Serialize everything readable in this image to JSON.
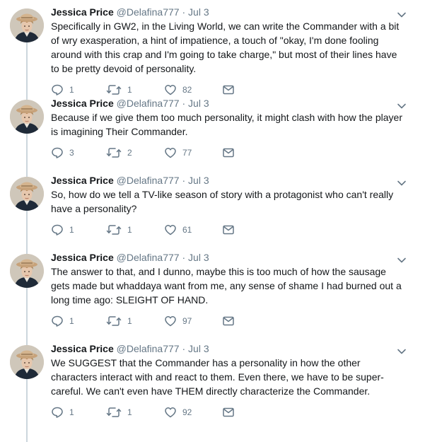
{
  "tweets": [
    {
      "name": "Jessica Price",
      "handle": "@Delafina777",
      "dot": "·",
      "date": "Jul 3",
      "text": "Specifically in GW2, in the Living World, we can write the Commander with a bit of wry exasperation, a hint of impatience, a touch of \"okay, I'm done fooling around with this crap and I'm going to take charge,\" but most of their lines have to be pretty devoid of personality.",
      "replies": "1",
      "retweets": "1",
      "likes": "82"
    },
    {
      "name": "Jessica Price",
      "handle": "@Delafina777",
      "dot": "·",
      "date": "Jul 3",
      "text": "Because if we give them too much personality, it might clash with how the player is imagining Their Commander.",
      "replies": "3",
      "retweets": "2",
      "likes": "77"
    },
    {
      "name": "Jessica Price",
      "handle": "@Delafina777",
      "dot": "·",
      "date": "Jul 3",
      "text": "So, how do we tell a TV-like season of story with a protagonist who can't really have a personality?",
      "replies": "1",
      "retweets": "1",
      "likes": "61"
    },
    {
      "name": "Jessica Price",
      "handle": "@Delafina777",
      "dot": "·",
      "date": "Jul 3",
      "text": "The answer to that, and I dunno, maybe this is too much of how the sausage gets made but whaddaya want from me, any sense of shame I had burned out a long time ago: SLEIGHT OF HAND.",
      "replies": "1",
      "retweets": "1",
      "likes": "97"
    },
    {
      "name": "Jessica Price",
      "handle": "@Delafina777",
      "dot": "·",
      "date": "Jul 3",
      "text": "We SUGGEST that the Commander has a personality in how the other characters interact with and react to them. Even there, we have to be super-careful. We can't even have THEM directly characterize the Commander.",
      "replies": "1",
      "retweets": "1",
      "likes": "92"
    }
  ],
  "icons": {
    "reply": "reply-icon",
    "retweet": "retweet-icon",
    "like": "heart-icon",
    "message": "envelope-icon",
    "more": "chevron-down-icon"
  },
  "colors": {
    "name": "#14171a",
    "secondary": "#657786",
    "icon": "#657786",
    "thread_line": "#ccd6dd"
  }
}
